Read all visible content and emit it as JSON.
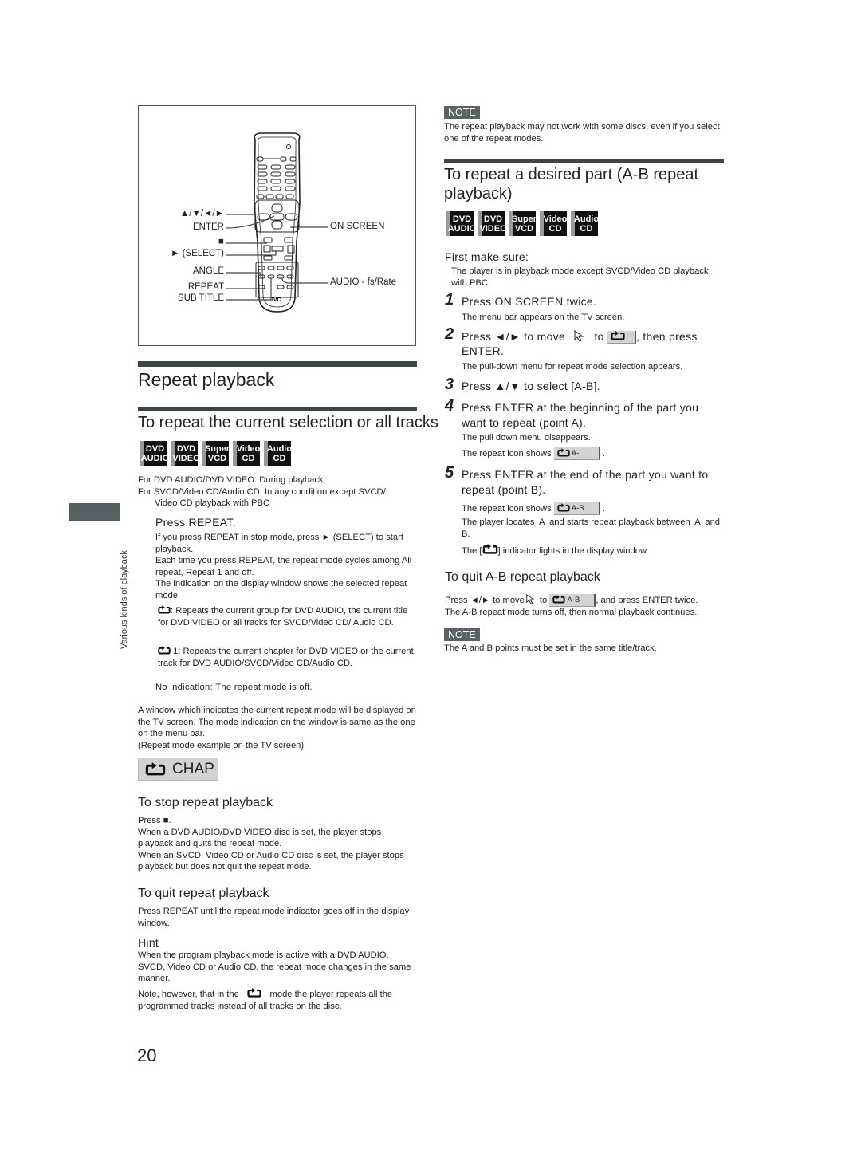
{
  "page_number": "20",
  "side_tab": {
    "label": "Various kinds of playback"
  },
  "remote_figure": {
    "left_labels": [
      "▲/▼/◄/►",
      "ENTER",
      "■",
      "► (SELECT)",
      "ANGLE",
      "REPEAT",
      "SUB TITLE"
    ],
    "right_labels": [
      "ON SCREEN",
      "AUDIO - fs/Rate"
    ],
    "brand": "JVC"
  },
  "disc_icons": [
    {
      "line1": "DVD",
      "line2": "AUDIO"
    },
    {
      "line1": "DVD",
      "line2": "VIDEO"
    },
    {
      "line1": "Super",
      "line2": "VCD"
    },
    {
      "line1": "Video",
      "line2": "CD"
    },
    {
      "line1": "Audio",
      "line2": "CD"
    }
  ],
  "left": {
    "title": "Repeat playback",
    "section_title": "To repeat the current selection or all tracks",
    "conditions": [
      "For DVD AUDIO/DVD VIDEO: During playback",
      "For SVCD/Video CD/Audio CD: In any condition except SVCD/",
      "Video CD playback with PBC"
    ],
    "step_title": "Press REPEAT.",
    "step_body": [
      "If you press REPEAT in stop mode, press ► (SELECT) to start playback.",
      "Each time you press REPEAT, the repeat mode cycles among All repeat, Repeat 1 and off.",
      "The indication on the display window shows the selected repeat mode."
    ],
    "mode_all": ": Repeats the current group for DVD AUDIO, the current title for DVD VIDEO or all tracks for SVCD/Video CD/ Audio CD.",
    "mode_one": "1: Repeats the current chapter for DVD VIDEO or the current track for DVD AUDIO/SVCD/Video CD/Audio CD.",
    "mode_off": "No indication: The repeat mode is off.",
    "window_text": "A window which indicates the current repeat mode will be displayed on the TV screen. The mode indication on the window is same as the one on the menu bar.",
    "window_caption": "(Repeat mode example on the TV screen)",
    "chap_label": "CHAP",
    "stop_title": "To stop repeat playback",
    "stop_body": [
      "Press ■.",
      "When a DVD AUDIO/DVD VIDEO disc is set, the player stops playback and quits the repeat mode.",
      "When an SVCD, Video CD or Audio CD disc is set, the player stops playback but does not quit the repeat mode."
    ],
    "quit_title": "To quit repeat playback",
    "quit_body": "Press REPEAT until the repeat mode indicator goes off in the display window.",
    "hint_title": "Hint",
    "hint_body": "When the program playback mode is active with a DVD AUDIO, SVCD, Video CD or Audio CD, the repeat mode changes in the same manner.",
    "hint_note_a": "Note, however, that in the",
    "hint_note_b": "mode the player repeats all the programmed tracks instead of all tracks on the disc."
  },
  "right": {
    "note1_label": "NOTE",
    "note1_text": "The repeat playback may not work with some discs, even if you select one of the repeat modes.",
    "section_title": "To repeat a desired part (A-B repeat playback)",
    "first_title": "First make sure:",
    "first_body": "The player is in playback mode except SVCD/Video CD playback with PBC.",
    "steps": [
      {
        "num": "1",
        "title": "Press ON SCREEN twice.",
        "body": "The menu bar appears on the TV screen."
      },
      {
        "num": "2",
        "title_a": "Press ◄/► to move",
        "title_b": "to",
        "title_c": ", then press ENTER.",
        "body": "The pull-down menu for repeat mode selection appears."
      },
      {
        "num": "3",
        "title": "Press ▲/▼ to select [A-B]."
      },
      {
        "num": "4",
        "title": "Press ENTER at the beginning of the part you want to repeat (point A).",
        "body": "The pull down menu disappears.",
        "icon_prefix": "The repeat icon shows",
        "icon_value": "A-"
      },
      {
        "num": "5",
        "title": "Press ENTER at the end of the part you want to repeat (point B).",
        "icon_prefix": "The repeat icon shows",
        "icon_value": "A-B",
        "body2": "The player locates  A  and starts repeat playback between  A  and  B.",
        "body3_a": "The [",
        "body3_b": "] indicator lights in the display window."
      }
    ],
    "quit_title": "To quit A-B repeat playback",
    "quit_a": "Press ◄/► to move",
    "quit_b": "to",
    "quit_chip": "A-B",
    "quit_c": ", and press ENTER twice.",
    "quit_line2": "The A-B repeat mode turns off, then normal playback continues.",
    "note2_label": "NOTE",
    "note2_text": "The A and B points must be set in the same title/track."
  },
  "colors": {
    "bar": "#3d4547",
    "note_bg": "#5b6264",
    "chip_bg": "#d3d3d3"
  }
}
